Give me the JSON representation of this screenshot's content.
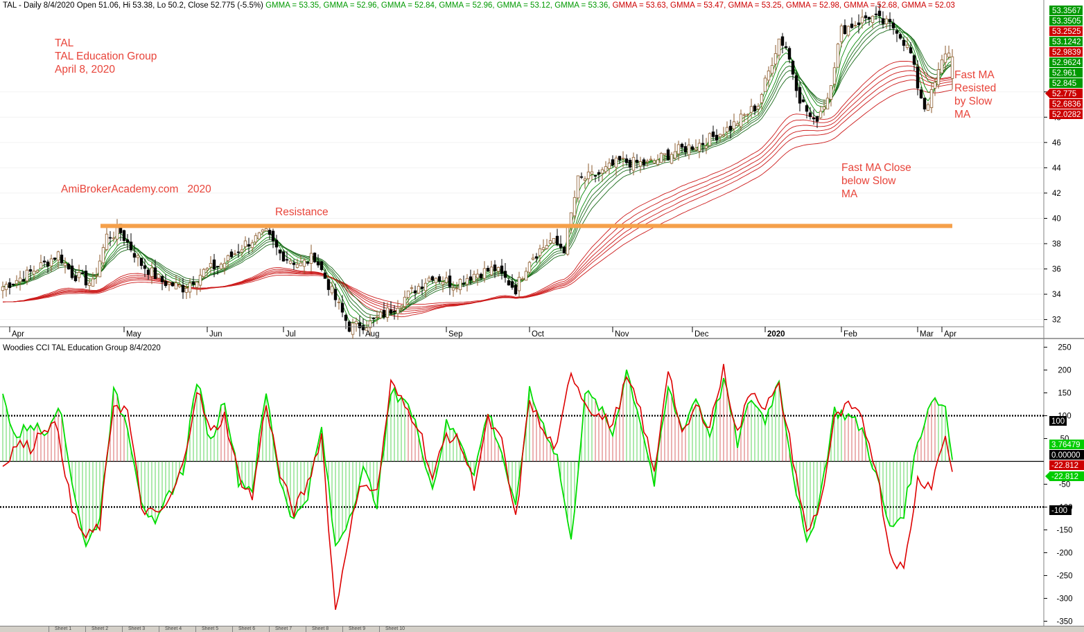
{
  "header": {
    "segments": [
      {
        "text": "TAL - Daily 8/4/2020 Open 51.06, Hi 53.38, Lo 50.2, Close 52.775 (-5.5%)",
        "color": "#000000"
      },
      {
        "text": " GMMA = 53.35,",
        "color": "#009900"
      },
      {
        "text": " GMMA = 52.96,",
        "color": "#009900"
      },
      {
        "text": " GMMA = 52.84,",
        "color": "#009900"
      },
      {
        "text": " GMMA = 52.96,",
        "color": "#009900"
      },
      {
        "text": " GMMA = 53.12,",
        "color": "#009900"
      },
      {
        "text": " GMMA = 53.36,",
        "color": "#009900"
      },
      {
        "text": " GMMA = 53.63,",
        "color": "#cc0000"
      },
      {
        "text": " GMMA = 53.47,",
        "color": "#cc0000"
      },
      {
        "text": " GMMA = 53.25,",
        "color": "#cc0000"
      },
      {
        "text": " GMMA = 52.98,",
        "color": "#cc0000"
      },
      {
        "text": " GMMA = 52.68,",
        "color": "#cc0000"
      },
      {
        "text": " GMMA = 52.03",
        "color": "#cc0000"
      }
    ]
  },
  "annotations": {
    "title_block": [
      "TAL",
      "TAL Education Group",
      "April 8, 2020"
    ],
    "website": "AmiBrokerAcademy.com   2020",
    "resistance": "Resistance",
    "fast_resisted": [
      "Fast MA",
      "Resisted",
      "by Slow",
      "MA"
    ],
    "fast_close": [
      "Fast MA Close",
      "below Slow",
      "MA"
    ]
  },
  "lower_title": "Woodies CCI  TAL Education Group 8/4/2020",
  "chart_data": [
    {
      "type": "candlestick",
      "name": "TAL - Daily",
      "months": [
        "Apr",
        "May",
        "Jun",
        "Jul",
        "Aug",
        "Sep",
        "Oct",
        "Nov",
        "Dec",
        "2020",
        "Feb",
        "Mar",
        "Apr"
      ],
      "ylim": [
        30.5,
        56.5
      ],
      "yticks": [
        32,
        34,
        36,
        38,
        40,
        42,
        44,
        46,
        48,
        50
      ],
      "resistance_level": 39.4,
      "close_anchors": [
        [
          0,
          34.6
        ],
        [
          6,
          35.4
        ],
        [
          12,
          36.4
        ],
        [
          16,
          37.2
        ],
        [
          20,
          35.6
        ],
        [
          26,
          34.8
        ],
        [
          30,
          38.6
        ],
        [
          34,
          38.9
        ],
        [
          40,
          36.4
        ],
        [
          46,
          35.0
        ],
        [
          52,
          34.5
        ],
        [
          58,
          35.8
        ],
        [
          64,
          36.5
        ],
        [
          70,
          38.0
        ],
        [
          76,
          38.8
        ],
        [
          80,
          37.2
        ],
        [
          86,
          36.3
        ],
        [
          90,
          37.0
        ],
        [
          96,
          33.6
        ],
        [
          100,
          31.4
        ],
        [
          106,
          31.7
        ],
        [
          112,
          32.8
        ],
        [
          118,
          34.2
        ],
        [
          124,
          35.5
        ],
        [
          130,
          34.8
        ],
        [
          136,
          35.6
        ],
        [
          142,
          36.0
        ],
        [
          148,
          34.4
        ],
        [
          152,
          36.8
        ],
        [
          158,
          38.2
        ],
        [
          162,
          37.6
        ],
        [
          166,
          43.0
        ],
        [
          172,
          43.5
        ],
        [
          178,
          44.5
        ],
        [
          186,
          44.3
        ],
        [
          194,
          45.3
        ],
        [
          202,
          46.0
        ],
        [
          210,
          47.2
        ],
        [
          218,
          49.0
        ],
        [
          224,
          54.2
        ],
        [
          226,
          53.6
        ],
        [
          230,
          49.5
        ],
        [
          234,
          47.5
        ],
        [
          238,
          49.6
        ],
        [
          242,
          54.9
        ],
        [
          246,
          55.4
        ],
        [
          250,
          56.0
        ],
        [
          254,
          55.5
        ],
        [
          258,
          55.0
        ],
        [
          262,
          53.0
        ],
        [
          264,
          50.5
        ],
        [
          266,
          48.8
        ],
        [
          268,
          49.8
        ],
        [
          272,
          53.2
        ],
        [
          274,
          52.775
        ]
      ],
      "gmma_fast_periods": [
        3,
        5,
        8,
        10,
        12,
        15
      ],
      "gmma_slow_periods": [
        30,
        35,
        40,
        45,
        50,
        60
      ],
      "gmma_fast_last": [
        53.35,
        52.96,
        52.84,
        52.96,
        53.12,
        53.36
      ],
      "gmma_slow_last": [
        53.63,
        53.47,
        53.25,
        52.98,
        52.68,
        52.03
      ],
      "axis_labels": [
        {
          "text": "53.3567",
          "bg": "#009900"
        },
        {
          "text": "53.3505",
          "bg": "#009900"
        },
        {
          "text": "53.2525",
          "bg": "#cc0000"
        },
        {
          "text": "53.1242",
          "bg": "#009900"
        },
        {
          "text": "52.9839",
          "bg": "#cc0000"
        },
        {
          "text": "52.9624",
          "bg": "#009900"
        },
        {
          "text": "52.961",
          "bg": "#009900"
        },
        {
          "text": "52.845",
          "bg": "#009900"
        },
        {
          "text": "52.775",
          "bg": "#cc0000"
        },
        {
          "text": "52.6836",
          "bg": "#cc0000"
        },
        {
          "text": "52.0282",
          "bg": "#cc0000"
        }
      ]
    },
    {
      "type": "line",
      "name": "Woodies CCI",
      "ylim": [
        -360,
        260
      ],
      "yticks": [
        250,
        200,
        150,
        100,
        50,
        -50,
        -100,
        -150,
        -200,
        -250,
        -300,
        -350
      ],
      "reference_levels": [
        100,
        0,
        -100
      ],
      "series": [
        {
          "name": "",
          "color": "#00dd00",
          "anchors": [
            [
              0,
              140
            ],
            [
              4,
              50
            ],
            [
              8,
              85
            ],
            [
              12,
              60
            ],
            [
              16,
              130
            ],
            [
              20,
              -40
            ],
            [
              24,
              -190
            ],
            [
              28,
              -120
            ],
            [
              32,
              150
            ],
            [
              36,
              80
            ],
            [
              40,
              -80
            ],
            [
              44,
              -150
            ],
            [
              48,
              -70
            ],
            [
              52,
              -20
            ],
            [
              56,
              180
            ],
            [
              60,
              40
            ],
            [
              64,
              140
            ],
            [
              68,
              -40
            ],
            [
              72,
              -60
            ],
            [
              76,
              150
            ],
            [
              80,
              -40
            ],
            [
              84,
              -130
            ],
            [
              88,
              -70
            ],
            [
              92,
              70
            ],
            [
              96,
              -190
            ],
            [
              100,
              -120
            ],
            [
              104,
              -20
            ],
            [
              108,
              -90
            ],
            [
              112,
              150
            ],
            [
              116,
              140
            ],
            [
              120,
              60
            ],
            [
              124,
              -60
            ],
            [
              128,
              80
            ],
            [
              132,
              50
            ],
            [
              136,
              -30
            ],
            [
              140,
              110
            ],
            [
              144,
              20
            ],
            [
              148,
              -110
            ],
            [
              152,
              150
            ],
            [
              156,
              80
            ],
            [
              160,
              10
            ],
            [
              164,
              -180
            ],
            [
              168,
              150
            ],
            [
              172,
              120
            ],
            [
              176,
              60
            ],
            [
              180,
              200
            ],
            [
              184,
              90
            ],
            [
              188,
              -50
            ],
            [
              192,
              160
            ],
            [
              196,
              70
            ],
            [
              200,
              140
            ],
            [
              204,
              60
            ],
            [
              208,
              180
            ],
            [
              212,
              40
            ],
            [
              216,
              140
            ],
            [
              220,
              90
            ],
            [
              224,
              180
            ],
            [
              228,
              -20
            ],
            [
              232,
              -190
            ],
            [
              236,
              -70
            ],
            [
              240,
              110
            ],
            [
              244,
              100
            ],
            [
              248,
              70
            ],
            [
              252,
              -30
            ],
            [
              256,
              -150
            ],
            [
              260,
              -110
            ],
            [
              264,
              40
            ],
            [
              268,
              140
            ],
            [
              272,
              120
            ],
            [
              274,
              3.76
            ]
          ]
        },
        {
          "name": "",
          "color": "#dd0000",
          "anchors": [
            [
              0,
              -10
            ],
            [
              4,
              40
            ],
            [
              8,
              30
            ],
            [
              12,
              80
            ],
            [
              16,
              70
            ],
            [
              20,
              -110
            ],
            [
              24,
              -170
            ],
            [
              28,
              -140
            ],
            [
              32,
              130
            ],
            [
              36,
              110
            ],
            [
              40,
              -100
            ],
            [
              44,
              -120
            ],
            [
              48,
              -90
            ],
            [
              52,
              -10
            ],
            [
              56,
              160
            ],
            [
              60,
              60
            ],
            [
              64,
              100
            ],
            [
              68,
              -30
            ],
            [
              72,
              -80
            ],
            [
              76,
              130
            ],
            [
              80,
              -30
            ],
            [
              84,
              -110
            ],
            [
              88,
              -50
            ],
            [
              92,
              60
            ],
            [
              96,
              -330
            ],
            [
              100,
              -150
            ],
            [
              104,
              -40
            ],
            [
              108,
              -70
            ],
            [
              112,
              170
            ],
            [
              116,
              120
            ],
            [
              120,
              80
            ],
            [
              124,
              -40
            ],
            [
              128,
              60
            ],
            [
              132,
              40
            ],
            [
              136,
              -50
            ],
            [
              140,
              90
            ],
            [
              144,
              40
            ],
            [
              148,
              -130
            ],
            [
              152,
              140
            ],
            [
              156,
              60
            ],
            [
              160,
              30
            ],
            [
              164,
              200
            ],
            [
              168,
              130
            ],
            [
              172,
              100
            ],
            [
              176,
              80
            ],
            [
              180,
              180
            ],
            [
              184,
              110
            ],
            [
              188,
              -30
            ],
            [
              192,
              210
            ],
            [
              196,
              50
            ],
            [
              200,
              120
            ],
            [
              204,
              80
            ],
            [
              208,
              200
            ],
            [
              212,
              60
            ],
            [
              216,
              160
            ],
            [
              220,
              120
            ],
            [
              224,
              160
            ],
            [
              228,
              10
            ],
            [
              232,
              -160
            ],
            [
              236,
              -90
            ],
            [
              240,
              90
            ],
            [
              244,
              120
            ],
            [
              248,
              90
            ],
            [
              252,
              -10
            ],
            [
              256,
              -200
            ],
            [
              260,
              -240
            ],
            [
              264,
              -40
            ],
            [
              268,
              -50
            ],
            [
              272,
              60
            ],
            [
              274,
              -22.812
            ]
          ]
        }
      ],
      "axis_labels": [
        {
          "text": "100",
          "bg": "#000000"
        },
        {
          "text": "3.76479",
          "bg": "#00cc00"
        },
        {
          "text": "0.00000",
          "bg": "#000000"
        },
        {
          "text": "-22.812",
          "bg": "#cc0000"
        },
        {
          "text": "-22.812",
          "bg": "#00cc00"
        },
        {
          "text": "-100",
          "bg": "#000000"
        }
      ]
    }
  ],
  "sheet_tabs": [
    "Sheet 1",
    "Sheet 2",
    "Sheet 3",
    "Sheet 4",
    "Sheet 5",
    "Sheet 6",
    "Sheet 7",
    "Sheet 8",
    "Sheet 9",
    "Sheet 10"
  ]
}
